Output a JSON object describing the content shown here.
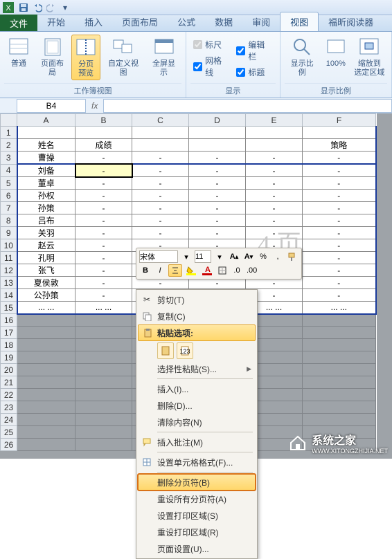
{
  "qat": {
    "save": "保存",
    "undo": "撤销",
    "redo": "重做"
  },
  "tabs": {
    "file": "文件",
    "items": [
      "开始",
      "插入",
      "页面布局",
      "公式",
      "数据",
      "审阅",
      "视图",
      "福昕阅读器"
    ],
    "active_index": 6
  },
  "ribbon": {
    "group1": {
      "label": "工作簿视图",
      "normal": "普通",
      "page_layout": "页面布局",
      "page_break": "分页\n预览",
      "custom_view": "自定义视图",
      "fullscreen": "全屏显示"
    },
    "group2": {
      "label": "显示",
      "ruler": "标尺",
      "gridlines": "网格线",
      "formula_bar": "编辑栏",
      "headings": "标题"
    },
    "group3": {
      "label": "显示比例",
      "zoom": "显示比例",
      "hundred": "100%",
      "to_selection": "缩放到\n选定区域"
    }
  },
  "namebox": "B4",
  "fx_label": "fx",
  "columns": [
    "A",
    "B",
    "C",
    "D",
    "E",
    "F"
  ],
  "rows": [
    {
      "n": 1,
      "A": "",
      "B": "",
      "C": "",
      "D": "",
      "E": "",
      "F": ""
    },
    {
      "n": 2,
      "A": "姓名",
      "B": "成绩",
      "C": "",
      "D": "",
      "E": "",
      "F": "策略"
    },
    {
      "n": 3,
      "A": "曹操",
      "B": "-",
      "C": "-",
      "D": "-",
      "E": "-",
      "F": "-"
    },
    {
      "n": 4,
      "A": "刘备",
      "B": "-",
      "C": "-",
      "D": "-",
      "E": "-",
      "F": "-"
    },
    {
      "n": 5,
      "A": "董卓",
      "B": "-",
      "C": "-",
      "D": "-",
      "E": "-",
      "F": "-"
    },
    {
      "n": 6,
      "A": "孙权",
      "B": "-",
      "C": "-",
      "D": "-",
      "E": "-",
      "F": "-"
    },
    {
      "n": 7,
      "A": "孙策",
      "B": "-",
      "C": "-",
      "D": "-",
      "E": "-",
      "F": "-"
    },
    {
      "n": 8,
      "A": "吕布",
      "B": "-",
      "C": "-",
      "D": "-",
      "E": "-",
      "F": "-"
    },
    {
      "n": 9,
      "A": "关羽",
      "B": "-",
      "C": "-",
      "D": "-",
      "E": "-",
      "F": "-"
    },
    {
      "n": 10,
      "A": "赵云",
      "B": "-",
      "C": "-",
      "D": "-",
      "E": "-",
      "F": "-"
    },
    {
      "n": 11,
      "A": "孔明",
      "B": "-",
      "C": "-",
      "D": "-",
      "E": "-",
      "F": "-"
    },
    {
      "n": 12,
      "A": "张飞",
      "B": "-",
      "C": "-",
      "D": "-",
      "E": "-",
      "F": "-"
    },
    {
      "n": 13,
      "A": "夏侯敦",
      "B": "-",
      "C": "-",
      "D": "-",
      "E": "-",
      "F": "-"
    },
    {
      "n": 14,
      "A": "公孙策",
      "B": "-",
      "C": "-",
      "D": "-",
      "E": "-",
      "F": "-"
    },
    {
      "n": 15,
      "A": "... ...",
      "B": "... ...",
      "C": "... ...",
      "D": "... ...",
      "E": "... ...",
      "F": "... ..."
    }
  ],
  "ghost_page": "4 页",
  "minitb": {
    "font": "宋体",
    "size": "11",
    "bold": "B",
    "italic": "I"
  },
  "ctx": {
    "cut": "剪切(T)",
    "copy": "复制(C)",
    "paste_options": "粘贴选项:",
    "paste_special": "选择性粘贴(S)...",
    "insert": "插入(I)...",
    "delete": "删除(D)...",
    "clear": "清除内容(N)",
    "insert_comment": "插入批注(M)",
    "format_cells": "设置单元格格式(F)...",
    "remove_page_break": "删除分页符(B)",
    "reset_all_breaks": "重设所有分页符(A)",
    "set_print_area": "设置打印区域(S)",
    "reset_print_area": "重设打印区域(R)",
    "page_setup": "页面设置(U)..."
  },
  "watermark": {
    "text1": "系统之家",
    "text2": "WWW.XITONGZHIJIA.NET"
  }
}
